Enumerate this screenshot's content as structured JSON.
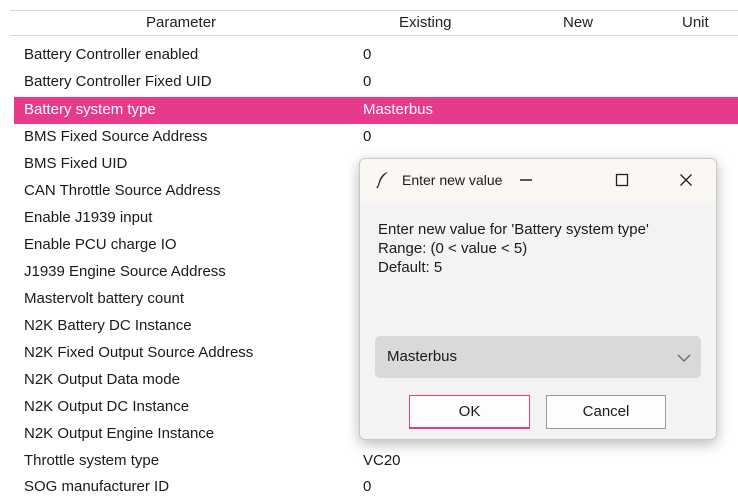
{
  "columns": [
    "Parameter",
    "Existing",
    "New",
    "Unit"
  ],
  "rows": [
    {
      "parameter": "Battery Controller enabled",
      "existing": "0"
    },
    {
      "parameter": "Battery Controller Fixed UID",
      "existing": "0"
    },
    {
      "parameter": "Battery system type",
      "existing": "Masterbus",
      "selected": true
    },
    {
      "parameter": "BMS Fixed Source Address",
      "existing": "0"
    },
    {
      "parameter": "BMS Fixed UID",
      "existing": ""
    },
    {
      "parameter": "CAN Throttle Source Address",
      "existing": ""
    },
    {
      "parameter": "Enable J1939 input",
      "existing": ""
    },
    {
      "parameter": "Enable PCU charge IO",
      "existing": ""
    },
    {
      "parameter": "J1939 Engine Source Address",
      "existing": ""
    },
    {
      "parameter": "Mastervolt battery count",
      "existing": ""
    },
    {
      "parameter": "N2K Battery DC Instance",
      "existing": ""
    },
    {
      "parameter": "N2K Fixed Output Source Address",
      "existing": ""
    },
    {
      "parameter": "N2K Output Data mode",
      "existing": ""
    },
    {
      "parameter": "N2K Output DC Instance",
      "existing": ""
    },
    {
      "parameter": "N2K Output Engine Instance",
      "existing": ""
    },
    {
      "parameter": "Throttle system type",
      "existing": "VC20"
    },
    {
      "parameter": "SOG manufacturer ID",
      "existing": "0"
    }
  ],
  "dialog": {
    "title": "Enter new value",
    "prompt": "Enter new value for 'Battery system type'",
    "range": "Range: (0 < value < 5)",
    "default": "Default: 5",
    "selected_value": "Masterbus",
    "ok_label": "OK",
    "cancel_label": "Cancel",
    "icons": {
      "title": "feather-icon",
      "minimize": "minimize-icon",
      "maximize": "maximize-icon",
      "close": "close-icon",
      "dropdown": "chevron-down-icon"
    }
  },
  "colors": {
    "selection": "#e83a8b",
    "ok_border": "#e83a8b"
  }
}
